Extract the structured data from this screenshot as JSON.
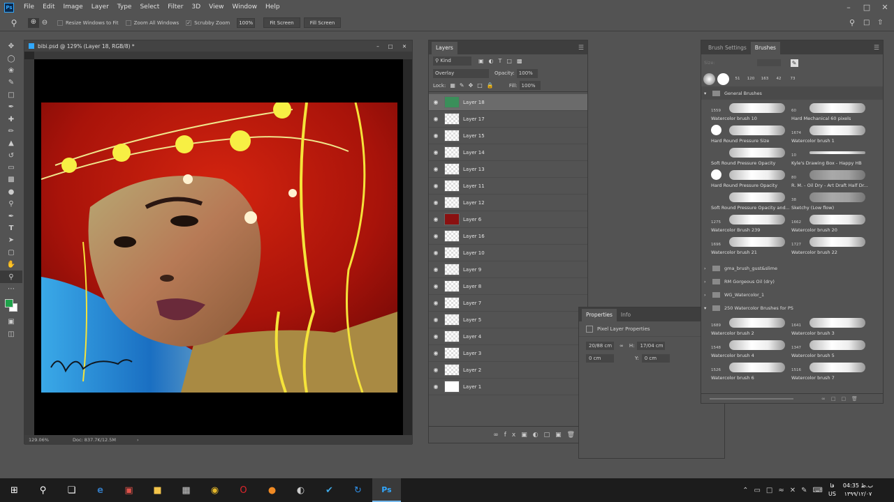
{
  "app": {
    "logo": "Ps",
    "menu": [
      "File",
      "Edit",
      "Image",
      "Layer",
      "Type",
      "Select",
      "Filter",
      "3D",
      "View",
      "Window",
      "Help"
    ]
  },
  "options_bar": {
    "resize_windows": "Resize Windows to Fit",
    "zoom_all": "Zoom All Windows",
    "scrubby_zoom": "Scrubby Zoom",
    "zoom_value": "100%",
    "fit_screen": "Fit Screen",
    "fill_screen": "Fill Screen"
  },
  "document": {
    "title": "bibi.psd @ 129% (Layer 18, RGB/8) *",
    "zoom": "129.06%",
    "doc_info": "Doc: 837.7K/12.5M"
  },
  "layers_panel": {
    "tab": "Layers",
    "kind": "Kind",
    "blend_mode": "Overlay",
    "opacity_label": "Opacity:",
    "opacity_value": "100%",
    "lock_label": "Lock:",
    "fill_label": "Fill:",
    "fill_value": "100%",
    "layers": [
      "Layer 18",
      "Layer 17",
      "Layer 15",
      "Layer 14",
      "Layer 13",
      "Layer 11",
      "Layer 12",
      "Layer 6",
      "Layer 16",
      "Layer 10",
      "Layer 9",
      "Layer 8",
      "Layer 7",
      "Layer 5",
      "Layer 4",
      "Layer 3",
      "Layer 2",
      "Layer 1"
    ]
  },
  "brushes_panel": {
    "tabs": [
      "Brush Settings",
      "Brushes"
    ],
    "size_label": "Size:",
    "recent_sizes": [
      "",
      "",
      "51",
      "120",
      "163",
      "42",
      "73"
    ],
    "group_general": "General Brushes",
    "general": [
      {
        "num": "1559",
        "name": "Watercolor brush 10"
      },
      {
        "num": "60",
        "name": "Hard Mechanical 60 pixels"
      },
      {
        "num": "",
        "name": "Hard Round Pressure Size"
      },
      {
        "num": "1674",
        "name": "Watercolor brush 1"
      },
      {
        "num": "",
        "name": "Soft Round Pressure Opacity"
      },
      {
        "num": "10",
        "name": "Kyle's Drawing Box - Happy HB"
      },
      {
        "num": "",
        "name": "Hard Round Pressure Opacity"
      },
      {
        "num": "80",
        "name": "R. M. - Oil Dry - Art Draft Half Dr..."
      },
      {
        "num": "",
        "name": "Soft Round Pressure Opacity and..."
      },
      {
        "num": "38",
        "name": "Sketchy (Low flow)"
      },
      {
        "num": "1275",
        "name": "Watercolor Brush 239"
      },
      {
        "num": "1662",
        "name": "Watercolor brush 20"
      },
      {
        "num": "1696",
        "name": "Watercolor brush 21"
      },
      {
        "num": "1727",
        "name": "Watercolor brush 22"
      }
    ],
    "folders": [
      "gma_brush_gust&slime",
      "RM Gorgeous Oil (dry)",
      "WG_Watercolor_1",
      "250 Watercolor Brushes for PS"
    ],
    "watercolor": [
      {
        "num": "1689",
        "name": "Watercolor brush 2"
      },
      {
        "num": "1641",
        "name": "Watercolor brush 3"
      },
      {
        "num": "1548",
        "name": "Watercolor brush 4"
      },
      {
        "num": "1347",
        "name": "Watercolor brush 5"
      },
      {
        "num": "1526",
        "name": "Watercolor brush 6"
      },
      {
        "num": "1516",
        "name": "Watercolor brush 7"
      }
    ]
  },
  "properties_panel": {
    "tabs": [
      "Properties",
      "Info"
    ],
    "heading": "Pixel Layer Properties",
    "w": "20/88 cm",
    "h_label": "H:",
    "h": "17/04 cm",
    "x": "0 cm",
    "y_label": "Y:",
    "y": "0 cm"
  },
  "taskbar": {
    "time": "04:35 ب.ظ",
    "date": "۱۳۹۹/۱۲/۰۷",
    "lang_top": "فا",
    "lang": "US"
  },
  "colors": {
    "accent": "#31a8ff",
    "panel": "#535353",
    "dark": "#3e3e3e"
  }
}
